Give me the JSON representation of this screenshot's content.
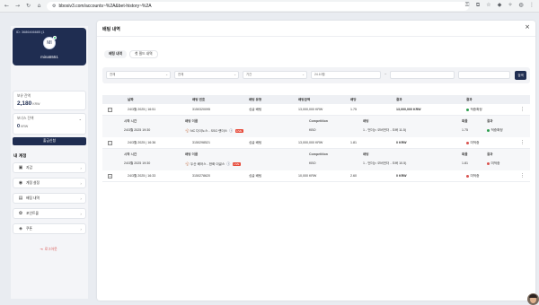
{
  "browser": {
    "url": "bbosiv3.com/accounts~%2A&bet-history~%2A",
    "nav": {
      "back": "←",
      "forward": "→",
      "reload": "↻",
      "home": "⌂"
    }
  },
  "sidebar": {
    "user_id": "ID: 3686466685 (1",
    "avatar_initials": "MI",
    "username": "mina5551",
    "balance_label": "보유 잔액",
    "balance_value": "2,180",
    "balance_unit": "KRW",
    "bonus_label": "보너스 잔액",
    "bonus_value": "0",
    "bonus_unit": "KRW",
    "withdraw_label": "출금신청",
    "my_label": "내 계정",
    "menu": [
      {
        "label": "지갑",
        "icon": "wallet-icon",
        "glyph": "▣"
      },
      {
        "label": "계정 설정",
        "icon": "user-settings-icon",
        "glyph": "◉"
      },
      {
        "label": "배팅 내역",
        "icon": "history-icon",
        "glyph": "▤"
      },
      {
        "label": "포인트몰",
        "icon": "gift-icon",
        "glyph": "✿"
      },
      {
        "label": "쿠폰",
        "icon": "coupon-icon",
        "glyph": "◈"
      }
    ],
    "logout_label": "로그아웃"
  },
  "main": {
    "title": "배팅 내역",
    "tabs": [
      "배팅 내역",
      "첫 필드 내역"
    ],
    "filters": {
      "sel1": "전체",
      "sel2": "전체",
      "sel3": "기간",
      "date_from": "24.10월",
      "sep": "~",
      "search_label": "검색"
    },
    "table": {
      "headers": [
        "날짜",
        "배팅 번호",
        "배팅 유형",
        "배팅금액",
        "배당",
        "결과",
        "결과"
      ],
      "rows": [
        {
          "date": "24/3월 2025 | 16:51",
          "bet_no": "3150320095",
          "type": "싱글 배팅",
          "amount": "13,000,000 KRW",
          "odds": "1.75",
          "payout": "13,000,000 KRW",
          "status": "적중확정",
          "status_color": "#2e9e4f",
          "sub_headers": [
            "시작 시간",
            "배팅 이름",
            "Competition",
            "배팅",
            "확률",
            "결과"
          ],
          "sub": {
            "time": "24/3월 2025 19:30",
            "match": "NC 다이노스 - SSG 랜더스",
            "tag": "LIVE",
            "comp": "KBO",
            "bet": "1 - 언더(&lt; 오버언더 - 오버 11.5)",
            "prob": "1.75",
            "status": "적중확정",
            "status_color": "#2e9e4f"
          }
        },
        {
          "date": "24/3월 2025 | 16:36",
          "bet_no": "3150298521",
          "type": "싱글 배팅",
          "amount": "13,000,000 KRW",
          "odds": "1.81",
          "payout": "0 KRW",
          "status": "미적중",
          "status_color": "#d9534f",
          "sub_headers": [
            "시작 시간",
            "배팅 이름",
            "Competition",
            "배팅",
            "확률",
            "결과"
          ],
          "sub": {
            "time": "24/3월 2025 19:30",
            "match": "두산 베어스 - 한화 이글스",
            "tag": "LIVE",
            "comp": "KBO",
            "bet": "1 - 언더(&lt; 오버언더 - 오버 10.5)",
            "prob": "1.81",
            "status": "미적중",
            "status_color": "#d9534f"
          }
        },
        {
          "date": "24/3월 2025 | 16:33",
          "bet_no": "3150278620",
          "type": "싱글 배팅",
          "amount": "10,000 KRW",
          "odds": "2.60",
          "payout": "0 KRW",
          "status": "미적중",
          "status_color": "#d9534f"
        }
      ]
    }
  }
}
